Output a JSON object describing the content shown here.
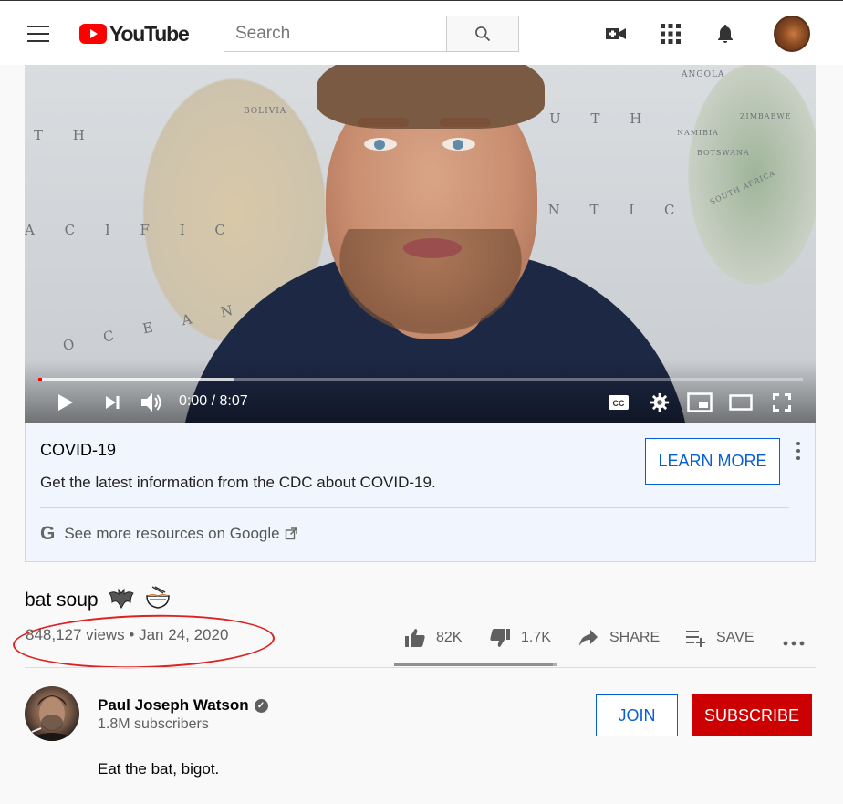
{
  "header": {
    "logo_text": "YouTube",
    "search_placeholder": "Search",
    "icons": [
      "menu-icon",
      "video-camera-plus-icon",
      "apps-grid-icon",
      "bell-icon",
      "account-avatar"
    ]
  },
  "player": {
    "time_current": "0:00",
    "time_separator": " / ",
    "time_total": "8:07",
    "buffered_fraction": 0.255,
    "played_fraction": 0.0,
    "map_labels": [
      "T H",
      "A C I F I C",
      "O C E A N",
      "O U T H",
      "A N T I C",
      "N",
      "BOLIVIA",
      "ANGOLA",
      "NAMIBIA",
      "BOTSWANA",
      "ZIMBABWE",
      "SOUTH AFRICA"
    ]
  },
  "covid_panel": {
    "title": "COVID-19",
    "description": "Get the latest information from the CDC about COVID-19.",
    "button_label": "LEARN MORE",
    "link_text": "See more resources on Google",
    "google_letter": "G"
  },
  "video": {
    "title": "bat soup",
    "views": "848,127 views",
    "dot": " • ",
    "date": "Jan 24, 2020",
    "likes": "82K",
    "dislikes": "1.7K",
    "share_label": "SHARE",
    "save_label": "SAVE",
    "like_fraction": 0.98
  },
  "channel": {
    "name": "Paul Joseph Watson",
    "subscribers": "1.8M subscribers",
    "join_label": "JOIN",
    "subscribe_label": "SUBSCRIBE",
    "description": "Eat the bat, bigot."
  },
  "colors": {
    "brand_red": "#ff0000",
    "subscribe_red": "#cc0000",
    "link_blue": "#065fd4",
    "annotation_red": "#dd2222"
  }
}
